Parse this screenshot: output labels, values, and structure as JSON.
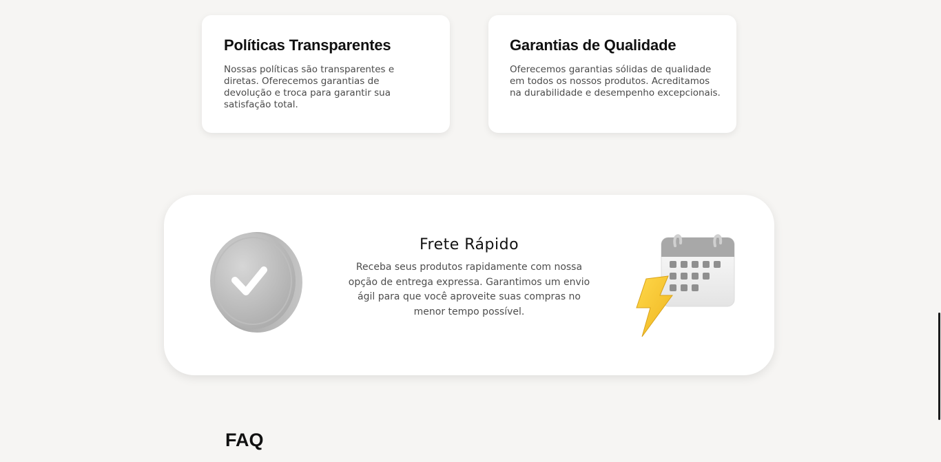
{
  "cards": [
    {
      "title": "Políticas Transparentes",
      "text": "Nossas políticas são transparentes e diretas. Oferecemos garantias de devolução e troca para garantir sua satisfação total."
    },
    {
      "title": "Garantias de Qualidade",
      "text": "Oferecemos garantias sólidas de qualidade em todos os nossos produtos. Acreditamos na durabilidade e desempenho excepcionais."
    }
  ],
  "feature": {
    "title": "Frete Rápido",
    "text": "Receba seus produtos rapidamente com nossa opção de entrega expressa. Garantimos um envio ágil para que você aproveite suas compras no menor tempo possível.",
    "left_icon": "check-coin-icon",
    "right_icon": "calendar-lightning-icon"
  },
  "faq": {
    "title": "FAQ"
  },
  "colors": {
    "background": "#f6f5f3",
    "card": "#ffffff",
    "heading": "#111111",
    "body_text": "#4a4a4a",
    "bolt": "#f5c830"
  }
}
